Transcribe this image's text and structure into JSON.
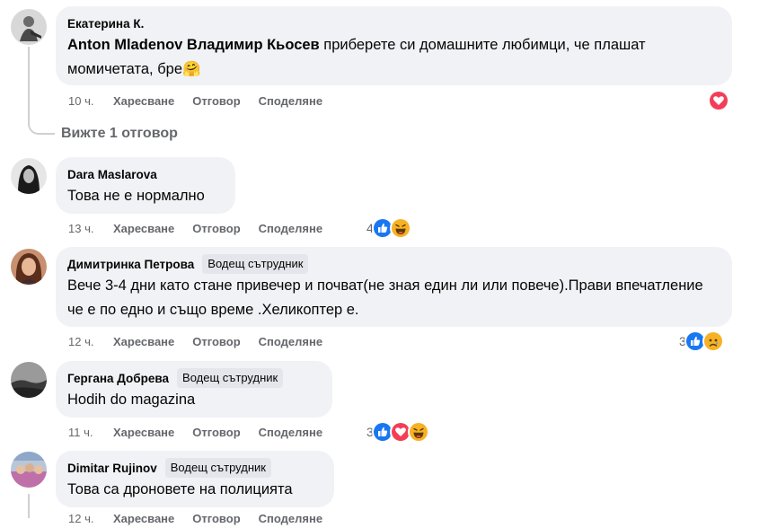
{
  "comments": [
    {
      "author": "Екатерина К.",
      "mention": "Anton Mladenov Владимир Кьосев",
      "text": " приберете си домашните любимци, че плашат момичетата, бре🤗",
      "time": "10 ч.",
      "like": "Харесване",
      "reply": "Отговор",
      "share": "Споделяне",
      "reactions": [
        "love"
      ],
      "reaction_count": ""
    },
    {
      "author": "Dara Maslarova",
      "text": "Това не е нормално",
      "time": "13 ч.",
      "like": "Харесване",
      "reply": "Отговор",
      "share": "Споделяне",
      "reactions": [
        "like",
        "haha"
      ],
      "reaction_count": "4"
    },
    {
      "author": "Димитринка Петрова",
      "badge": "Водещ сътрудник",
      "text": "Вече 3-4 дни като стане привечер и почват(не зная един ли или повече).Прави впечатление че е по едно и също време .Хеликоптер е.",
      "time": "12 ч.",
      "like": "Харесване",
      "reply": "Отговор",
      "share": "Споделяне",
      "reactions": [
        "like",
        "sad"
      ],
      "reaction_count": "3"
    },
    {
      "author": "Гергана Добрева",
      "badge": "Водещ сътрудник",
      "text": "Hodih do magazina",
      "time": "11 ч.",
      "like": "Харесване",
      "reply": "Отговор",
      "share": "Споделяне",
      "reactions": [
        "like",
        "love",
        "haha"
      ],
      "reaction_count": "3"
    },
    {
      "author": "Dimitar Rujinov",
      "badge": "Водещ сътрудник",
      "text": "Това са дроновете на полицията",
      "time": "12 ч.",
      "like": "Харесване",
      "reply": "Отговор",
      "share": "Споделяне"
    }
  ],
  "view_replies": "Вижте 1 отговор",
  "colors": {
    "bubble": "#f0f2f5",
    "secondary_text": "#65676b",
    "like_blue": "#1877f2",
    "love_red": "#f33e58",
    "haha_yellow": "#f7b125"
  }
}
